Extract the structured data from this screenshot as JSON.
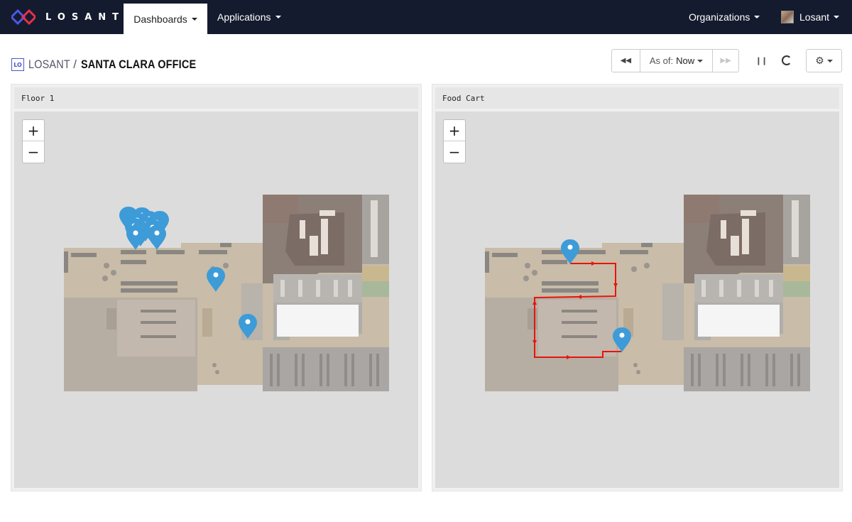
{
  "brand": {
    "name": "LOSANT",
    "accent": "#4a58c8"
  },
  "nav": {
    "dashboards": "Dashboards",
    "applications": "Applications",
    "organizations": "Organizations",
    "user": "Losant"
  },
  "breadcrumb": {
    "badge": "LO",
    "app": "LOSANT",
    "separator": "/",
    "title": "SANTA CLARA OFFICE"
  },
  "toolbar": {
    "as_of_label": "As of:",
    "as_of_value": "Now"
  },
  "panels": [
    {
      "title": "Floor 1",
      "zoom_in": "+",
      "zoom_out": "−"
    },
    {
      "title": "Food Cart",
      "zoom_in": "+",
      "zoom_out": "−"
    }
  ],
  "colors": {
    "marker": "#3d9bd8",
    "path": "#e8140c",
    "nav_bg": "#151b2e"
  }
}
